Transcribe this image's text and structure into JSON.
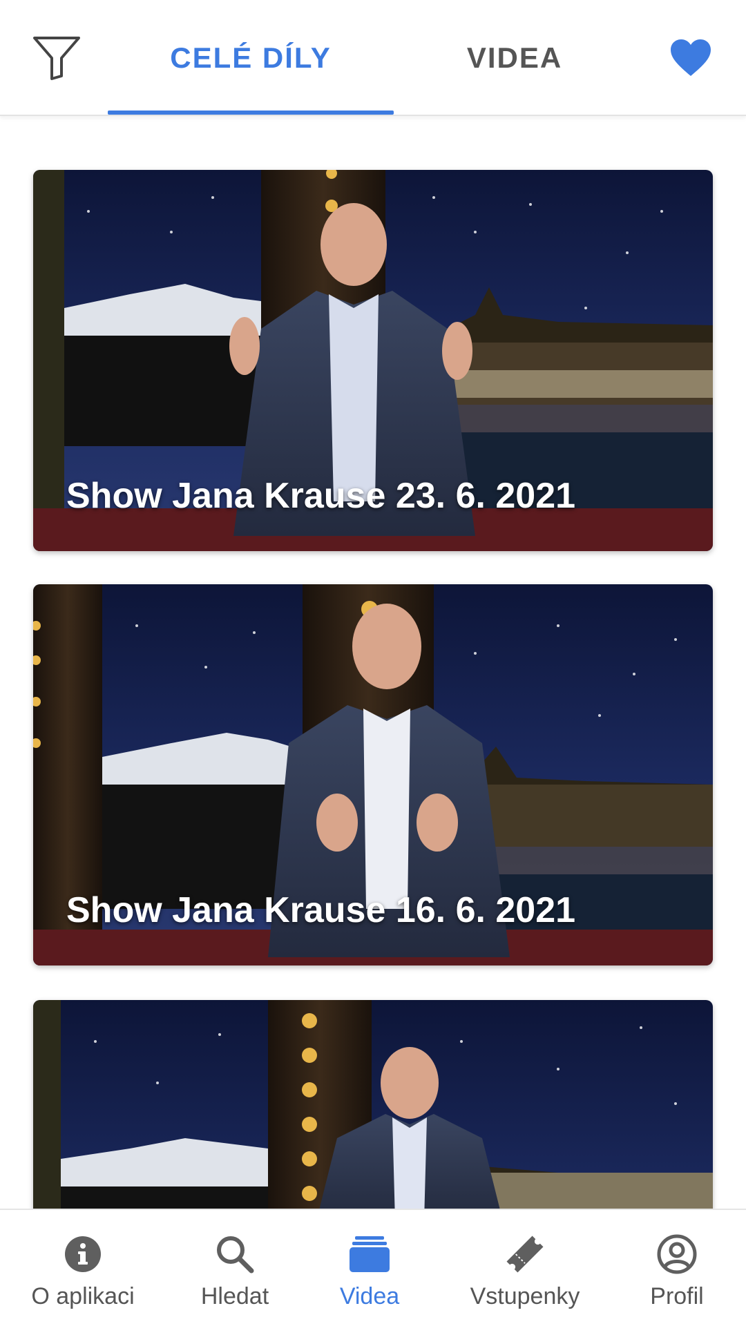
{
  "header": {
    "tabs": [
      {
        "label": "CELÉ DÍLY",
        "active": true
      },
      {
        "label": "VIDEA",
        "active": false
      }
    ],
    "filter_icon": "filter-icon",
    "favorites_icon": "heart-icon"
  },
  "videos": [
    {
      "title": "Show Jana Krause 23. 6. 2021"
    },
    {
      "title": "Show Jana Krause 16. 6. 2021"
    },
    {
      "title": ""
    }
  ],
  "bottom_nav": {
    "items": [
      {
        "label": "O aplikaci",
        "icon": "info-icon",
        "active": false
      },
      {
        "label": "Hledat",
        "icon": "search-icon",
        "active": false
      },
      {
        "label": "Videa",
        "icon": "videos-icon",
        "active": true
      },
      {
        "label": "Vstupenky",
        "icon": "ticket-icon",
        "active": false
      },
      {
        "label": "Profil",
        "icon": "profile-icon",
        "active": false
      }
    ]
  },
  "colors": {
    "accent": "#3d7be0",
    "inactive": "#555555",
    "icon_gray": "#5f5f5f"
  }
}
